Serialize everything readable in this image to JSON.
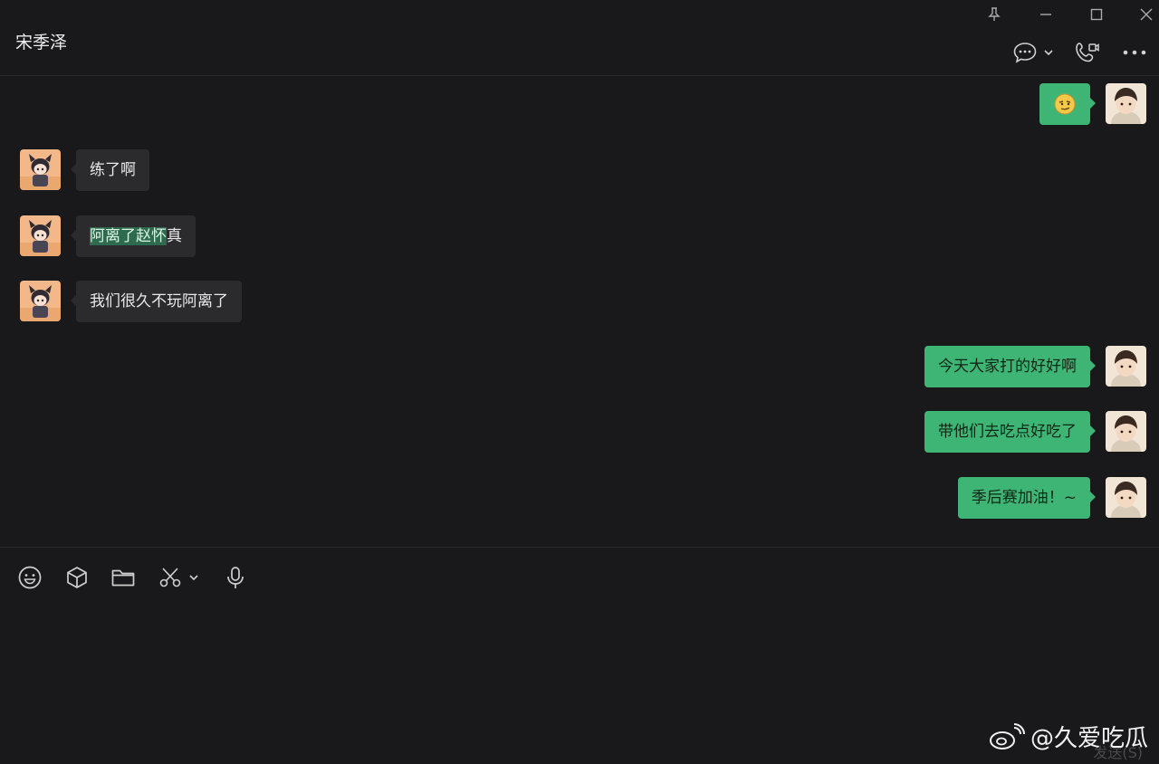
{
  "header": {
    "title": "宋季泽"
  },
  "messages": [
    {
      "dir": "out",
      "kind": "emoji",
      "emoji": "smirk-emoji-icon"
    },
    {
      "dir": "in",
      "text": "练了啊"
    },
    {
      "dir": "in",
      "text_highlight": "阿离了赵怀",
      "text_rest": "真"
    },
    {
      "dir": "in",
      "text": "我们很久不玩阿离了"
    },
    {
      "dir": "out",
      "text": "今天大家打的好好啊"
    },
    {
      "dir": "out",
      "text": "带他们去吃点好吃了"
    },
    {
      "dir": "out",
      "text": "季后赛加油！~"
    }
  ],
  "composer": {
    "send_label": "发送(S)"
  },
  "watermark": {
    "text": "@久爱吃瓜"
  },
  "colors": {
    "outgoing_bubble": "#3eb575",
    "incoming_bubble": "#2b2b2d",
    "background": "#19191b"
  }
}
